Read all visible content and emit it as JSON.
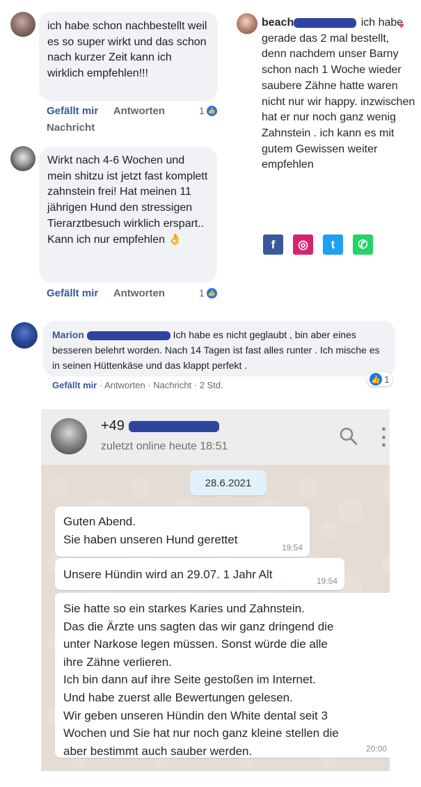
{
  "fb": {
    "comment1": {
      "text": "ich habe schon nachbestellt weil es so super wirkt und das schon nach kurzer Zeit kann ich wirklich empfehlen!!!",
      "like": "Gefällt mir",
      "reply": "Antworten",
      "message": "Nachricht",
      "reactions": "1"
    },
    "comment2": {
      "text": "Wirkt nach 4-6 Wochen und mein shitzu ist jetzt fast komplett zahnstein frei! Hat meinen 11 jährigen Hund den stressigen Tierarztbesuch wirklich erspart.. Kann ich nur empfehlen",
      "emoji": "👌",
      "like": "Gefällt mir",
      "reply": "Antworten",
      "reactions": "1"
    },
    "comment3": {
      "author": "Marion",
      "text": "Ich habe es nicht geglaubt , bin aber eines besseren belehrt worden. Nach 14 Tagen ist fast alles runter . Ich mische es in seinen Hüttenkäse und das klappt perfekt .",
      "like": "Gefällt mir",
      "sep": " · ",
      "reply": "Antworten",
      "message": "Nachricht",
      "time": "2 Std.",
      "reactions": "1"
    }
  },
  "insta": {
    "user": "beach",
    "text": "ich habe gerade das 2 mal bestellt, denn nachdem unser Barny schon nach 1 Woche wieder saubere Zähne hatte waren nicht nur wir happy. inzwischen hat er nur noch ganz wenig Zahnstein . ich kann es mit gutem Gewissen weiter empfehlen",
    "heart": "♥"
  },
  "share": {
    "facebook": "f",
    "instagram": "◎",
    "twitter": "t",
    "whatsapp": "✆"
  },
  "whatsapp": {
    "contact_prefix": "+49",
    "status": "zuletzt online heute 18:51",
    "date": "28.6.2021",
    "messages": [
      {
        "lines": [
          "Guten Abend.",
          "Sie haben unseren Hund gerettet"
        ],
        "time": "19:54"
      },
      {
        "lines": [
          "Unsere Hündin wird an 29.07. 1 Jahr Alt"
        ],
        "time": "19:54"
      },
      {
        "lines": [
          "Sie hatte so ein starkes Karies und Zahnstein.",
          "Das die Ärzte uns sagten das wir ganz dringend die",
          "unter Narkose legen müssen. Sonst würde die alle",
          "ihre Zähne verlieren.",
          "Ich bin dann auf ihre Seite gestoßen im Internet.",
          "Und habe zuerst alle Bewertungen gelesen.",
          "Wir geben unseren Hündin den White dental seit 3",
          "Wochen und Sie hat nur noch ganz kleine stellen die",
          "aber bestimmt auch sauber werden."
        ],
        "time": "20:00"
      }
    ]
  },
  "colors": {
    "fb_link": "#385898",
    "fb_like": "#1877f2",
    "redaction": "#2e45a0",
    "wa_bubble": "#ffffff",
    "wa_date": "#e1f2fb"
  }
}
